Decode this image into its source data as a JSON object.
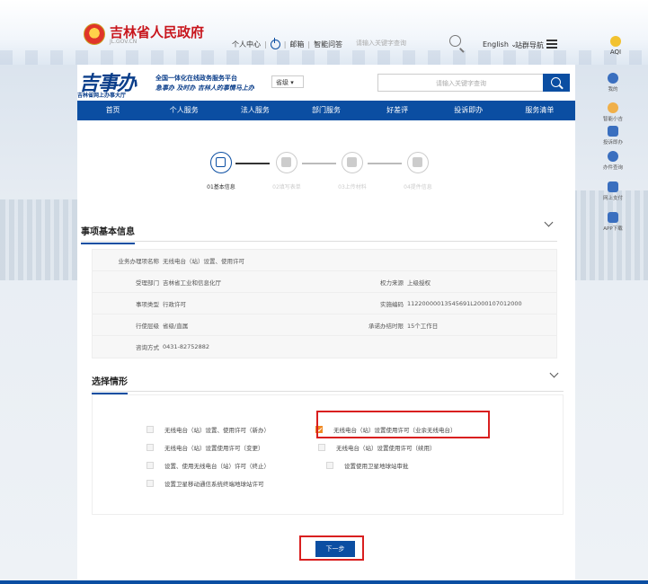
{
  "gov": {
    "title": "吉林省人民政府",
    "subtitle": "JL.GOV.CN",
    "links": [
      "个人中心",
      "邮箱",
      "智能问答"
    ],
    "search_placeholder": "请输入关键字查询",
    "language": "English",
    "site_nav": "站群导航",
    "aqi": "AQI"
  },
  "header": {
    "logo": "吉事办",
    "logo_sub": "吉林省网上办事大厅",
    "slogan_line1": "全国一体化在线政务服务平台",
    "slogan_line2": "急事办 及时办 吉林人的事情马上办",
    "region": "省级",
    "search_placeholder": "请输入关键字查询"
  },
  "nav": [
    "首页",
    "个人服务",
    "法人服务",
    "部门服务",
    "好差评",
    "投诉即办",
    "服务清单"
  ],
  "steps": [
    {
      "label": "01基本信息",
      "active": true
    },
    {
      "label": "02填写表单",
      "active": false
    },
    {
      "label": "03上传材料",
      "active": false
    },
    {
      "label": "04提件信息",
      "active": false
    }
  ],
  "basic_info": {
    "title": "事项基本信息",
    "item_name_label": "业务办理项名称",
    "item_name": "无线电台（站）设置、使用许可",
    "dept_label": "受理部门",
    "dept": "吉林省工业和信息化厅",
    "source_label": "权力来源",
    "source": "上级授权",
    "type_label": "事项类型",
    "type": "行政许可",
    "code_label": "实施编码",
    "code": "11220000013545691L2000107012000",
    "level_label": "行使层级",
    "level": "省级/直属",
    "time_label": "承诺办结时限",
    "time": "15个工作日",
    "phone_label": "咨询方式",
    "phone": "0431-82752882"
  },
  "situation": {
    "title": "选择情形",
    "options": [
      {
        "label": "无线电台（站）设置、使用许可（新办）",
        "checked": false
      },
      {
        "label": "无线电台（站）设置使用许可（业余无线电台）",
        "checked": true
      },
      {
        "label": "无线电台（站）设置使用许可（变更）",
        "checked": false
      },
      {
        "label": "无线电台（站）设置使用许可（续用）",
        "checked": false
      },
      {
        "label": "设置、使用无线电台（站）许可（终止）",
        "checked": false
      },
      {
        "label": "设置使用卫星地球站审批",
        "checked": false
      },
      {
        "label": "设置卫星移动通信系统终端地球站许可",
        "checked": false
      }
    ]
  },
  "next_button": "下一步",
  "sidebar": [
    "我的",
    "智能小吉",
    "投诉即办",
    "办件查询",
    "网上支付",
    "APP下载"
  ],
  "colors": {
    "brand": "#0b4ea2",
    "checked": "#f08a24",
    "highlight": "#d91f1f",
    "gov_red": "#c8161d"
  }
}
